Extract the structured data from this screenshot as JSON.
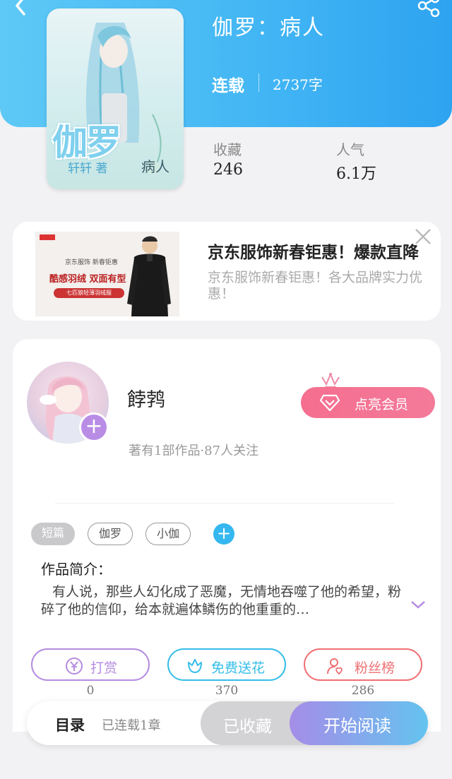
{
  "header": {
    "back_icon": "chevron-left-icon",
    "share_icon": "share-icon",
    "title": "伽罗：病人",
    "status": "连载",
    "word_count": "2737字"
  },
  "cover": {
    "title_text": "伽罗",
    "author_text": "轩轩 著",
    "subtitle_text": "病人"
  },
  "stats": {
    "favorites_label": "收藏",
    "favorites_value": "246",
    "popularity_label": "人气",
    "popularity_value": "6.1万"
  },
  "ad": {
    "title": "京东服饰新春钜惠！爆款直降",
    "description": "京东服饰新春钜惠！各大品牌实力优惠！",
    "image_lines": [
      "京东服饰  新春钜惠",
      "酷感羽绒 双面有型",
      "七匹狼轻薄羽绒服"
    ],
    "close_icon": "close-icon"
  },
  "author": {
    "name": "餑鹁",
    "meta": "著有1部作品·87人关注",
    "vip_label": "点亮会员",
    "follow_icon": "plus-icon"
  },
  "tags": [
    "短篇",
    "伽罗",
    "小伽"
  ],
  "intro": {
    "heading": "作品简介：",
    "text": "有人说，那些人幻化成了恶魔，无情地吞噬了他的希望，粉碎了他的信仰，给本就遍体鳞伤的他重重的…"
  },
  "actions": [
    {
      "label": "打赏",
      "count": "0",
      "icon": "yen-coin-icon",
      "color": "#b58be0"
    },
    {
      "label": "免费送花",
      "count": "370",
      "icon": "flower-icon",
      "color": "#35bde8"
    },
    {
      "label": "粉丝榜",
      "count": "286",
      "icon": "user-heart-icon",
      "color": "#ef6f73"
    }
  ],
  "bottom": {
    "toc_label": "目录",
    "toc_sub": "已连载1章",
    "collected_label": "已收藏",
    "read_label": "开始阅读"
  }
}
